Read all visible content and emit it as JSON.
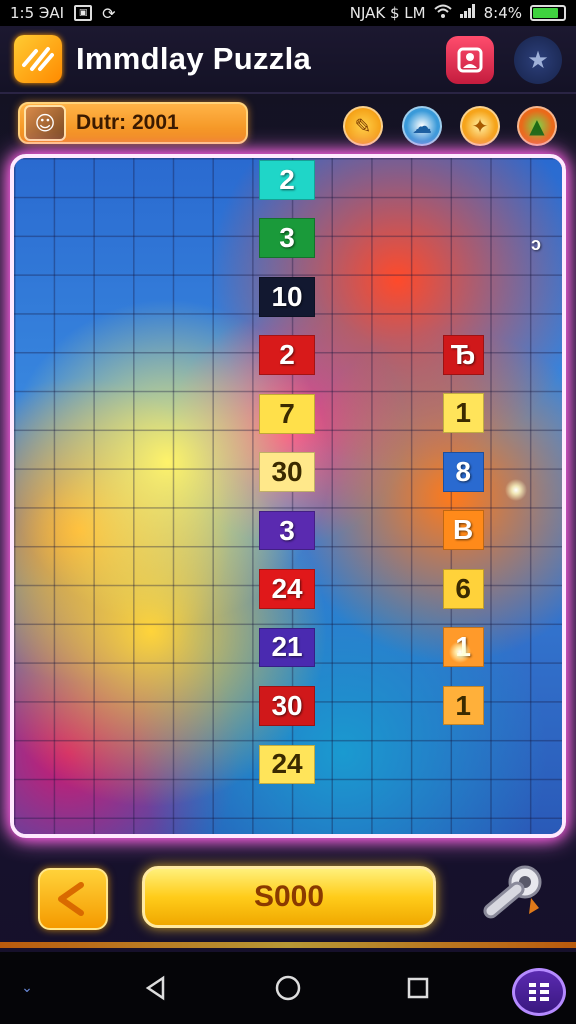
{
  "status_bar": {
    "time": "1:5 ЭAI",
    "carrier": "NJAK  $  LM",
    "battery": "8:4%",
    "battery_level": 0.84
  },
  "header": {
    "title": "Immdlay Puzzla",
    "logo_icon": "puzzle-logo-icon",
    "profile_icon": "profile-icon",
    "star_icon": "star-icon"
  },
  "info": {
    "score_label": "Dutr: 2001",
    "powerups": [
      "wrench-powerup-icon",
      "cloud-powerup-icon",
      "star-powerup-icon",
      "cone-powerup-icon"
    ]
  },
  "board": {
    "columns": 14,
    "rows": 17,
    "center_column_tiles": [
      {
        "value": "2",
        "color": "#1fd6c8"
      },
      {
        "value": "3",
        "color": "#1a9a3a"
      },
      {
        "value": "10",
        "color": "#121830"
      },
      {
        "value": "2",
        "color": "#d81a1a"
      },
      {
        "value": "7",
        "color": "#ffe04a"
      },
      {
        "value": "30",
        "color": "#ffe88a"
      },
      {
        "value": "3",
        "color": "#5a2ab0"
      },
      {
        "value": "24",
        "color": "#e0181a"
      },
      {
        "value": "21",
        "color": "#4a2ab0"
      },
      {
        "value": "30",
        "color": "#d0181a"
      },
      {
        "value": "24",
        "color": "#ffe45a"
      }
    ],
    "right_column_tiles": [
      {
        "value": "Ђ",
        "color": "#d0181a"
      },
      {
        "value": "1",
        "color": "#ffe45a"
      },
      {
        "value": "8",
        "color": "#2a6ad0"
      },
      {
        "value": "B",
        "color": "#ff8a1a"
      },
      {
        "value": "6",
        "color": "#ffd23a"
      },
      {
        "value": "1",
        "color": "#ff9a2a"
      },
      {
        "value": "1",
        "color": "#ffb03a"
      }
    ],
    "corner_label": "ɔ"
  },
  "controls": {
    "back_icon": "back-arrow-icon",
    "main_button_label": "S000",
    "wrench_icon": "wrench-icon"
  },
  "nav": {
    "back_icon": "nav-back-icon",
    "home_icon": "nav-home-icon",
    "recents_icon": "nav-recents-icon",
    "menu_icon": "menu-grid-icon"
  }
}
